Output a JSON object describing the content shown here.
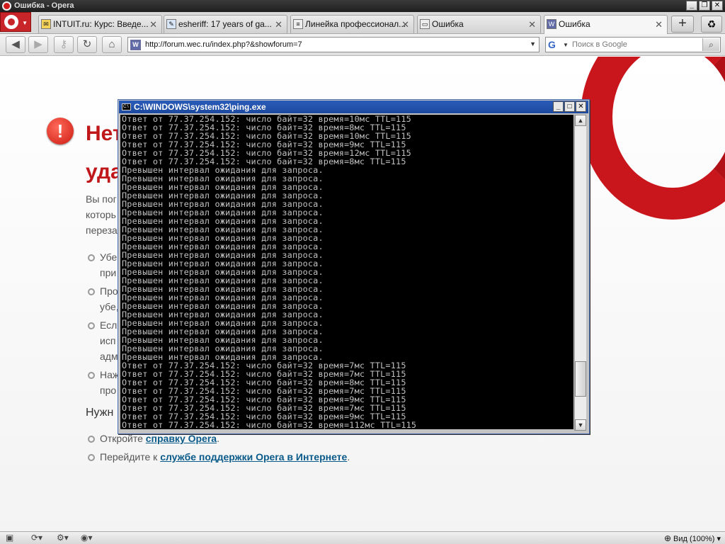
{
  "window": {
    "title": "Ошибка - Opera"
  },
  "tabs": [
    {
      "label": "INTUIT.ru: Курс: Введе...",
      "icon": "intuit-icon"
    },
    {
      "label": "esheriff: 17 years of ga...",
      "icon": "livejournal-icon"
    },
    {
      "label": "Линейка профессионал...",
      "icon": "page-icon"
    },
    {
      "label": "Ошибка",
      "icon": "window-icon"
    },
    {
      "label": "Ошибка",
      "icon": "w-icon"
    }
  ],
  "toolbar": {
    "url": "http://forum.wec.ru/index.php?&showforum=7",
    "search_placeholder": "Поиск в Google"
  },
  "page": {
    "heading_1": "Нет",
    "heading_2": "уда",
    "para_lines": [
      "Вы пог",
      "которь",
      "переза"
    ],
    "bullets": [
      [
        "Убе",
        "при"
      ],
      [
        "Про",
        "убе,"
      ],
      [
        "Есл",
        "исп",
        "адм"
      ],
      [
        "Наж",
        "про"
      ]
    ],
    "need_help": "Нужн",
    "help_items": [
      {
        "prefix": "Откройте ",
        "link": "справку Opera",
        "suffix": "."
      },
      {
        "prefix": "Перейдите к ",
        "link": "службе поддержки Opera в Интернете",
        "suffix": "."
      }
    ]
  },
  "console": {
    "title": "C:\\WINDOWS\\system32\\ping.exe",
    "lines": [
      "Ответ от 77.37.254.152: число байт=32 время=10мс TTL=115",
      "Ответ от 77.37.254.152: число байт=32 время=8мс TTL=115",
      "Ответ от 77.37.254.152: число байт=32 время=10мс TTL=115",
      "Ответ от 77.37.254.152: число байт=32 время=9мс TTL=115",
      "Ответ от 77.37.254.152: число байт=32 время=12мс TTL=115",
      "Ответ от 77.37.254.152: число байт=32 время=8мс TTL=115",
      "Превышен интервал ожидания для запроса.",
      "Превышен интервал ожидания для запроса.",
      "Превышен интервал ожидания для запроса.",
      "Превышен интервал ожидания для запроса.",
      "Превышен интервал ожидания для запроса.",
      "Превышен интервал ожидания для запроса.",
      "Превышен интервал ожидания для запроса.",
      "Превышен интервал ожидания для запроса.",
      "Превышен интервал ожидания для запроса.",
      "Превышен интервал ожидания для запроса.",
      "Превышен интервал ожидания для запроса.",
      "Превышен интервал ожидания для запроса.",
      "Превышен интервал ожидания для запроса.",
      "Превышен интервал ожидания для запроса.",
      "Превышен интервал ожидания для запроса.",
      "Превышен интервал ожидания для запроса.",
      "Превышен интервал ожидания для запроса.",
      "Превышен интервал ожидания для запроса.",
      "Превышен интервал ожидания для запроса.",
      "Превышен интервал ожидания для запроса.",
      "Превышен интервал ожидания для запроса.",
      "Превышен интервал ожидания для запроса.",
      "Превышен интервал ожидания для запроса.",
      "Ответ от 77.37.254.152: число байт=32 время=7мс TTL=115",
      "Ответ от 77.37.254.152: число байт=32 время=7мс TTL=115",
      "Ответ от 77.37.254.152: число байт=32 время=8мс TTL=115",
      "Ответ от 77.37.254.152: число байт=32 время=7мс TTL=115",
      "Ответ от 77.37.254.152: число байт=32 время=9мс TTL=115",
      "Ответ от 77.37.254.152: число байт=32 время=7мс TTL=115",
      "Ответ от 77.37.254.152: число байт=32 время=9мс TTL=115",
      "Ответ от 77.37.254.152: число байт=32 время=112мс TTL=115"
    ]
  },
  "statusbar": {
    "zoom": "Вид (100%)"
  },
  "colors": {
    "opera_red": "#c8161c",
    "console_bg": "#000000",
    "console_fg": "#c0c0c0",
    "link": "#0a5a8a"
  }
}
